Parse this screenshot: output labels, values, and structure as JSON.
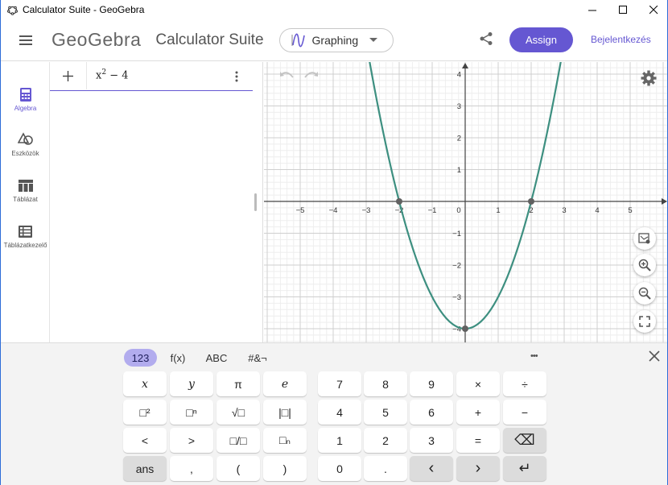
{
  "window": {
    "title": "Calculator Suite - GeoGebra"
  },
  "header": {
    "logo": "GeoGebra",
    "suite": "Calculator Suite",
    "app_picker": "Graphing",
    "assign": "Assign",
    "login": "Bejelentkezés"
  },
  "sidenav": {
    "items": [
      {
        "label": "Algebra",
        "icon": "calculator-icon",
        "active": true
      },
      {
        "label": "Eszközök",
        "icon": "shapes-icon",
        "active": false
      },
      {
        "label": "Táblázat",
        "icon": "table-icon",
        "active": false
      },
      {
        "label": "Táblázatkezelő",
        "icon": "spreadsheet-icon",
        "active": false
      }
    ]
  },
  "algebra": {
    "expression_base": "x",
    "expression_exp": "2",
    "expression_rest": " − 4"
  },
  "graph": {
    "function": "x^2 - 4",
    "x_ticks": [
      "−5",
      "−4",
      "−3",
      "−2",
      "−1",
      "0",
      "1",
      "2",
      "3",
      "4",
      "5"
    ],
    "y_ticks": [
      "4",
      "3",
      "2",
      "1",
      "−1",
      "−2",
      "−3",
      "−4"
    ],
    "roots": [
      -2,
      2
    ],
    "vertex": [
      0,
      -4
    ],
    "curve_color": "#3d8f80",
    "point_color": "#616161"
  },
  "keyboard": {
    "tabs": [
      "123",
      "f(x)",
      "ABC",
      "#&¬"
    ],
    "left_rows": [
      [
        "x",
        "y",
        "π",
        "e"
      ],
      [
        "□²",
        "□ⁿ",
        "√□",
        "|□|"
      ],
      [
        "<",
        ">",
        "□/□",
        "□ₙ"
      ],
      [
        "ans",
        ",",
        "(",
        ")"
      ]
    ],
    "right_rows": [
      [
        "7",
        "8",
        "9",
        "×",
        "÷"
      ],
      [
        "4",
        "5",
        "6",
        "+",
        "−"
      ],
      [
        "1",
        "2",
        "3",
        "=",
        "⌫"
      ],
      [
        "0",
        ".",
        "‹",
        "›",
        "↵"
      ]
    ],
    "more": "•••",
    "close": "×"
  },
  "colors": {
    "accent": "#6557d2",
    "active_tab": "#b2acee"
  }
}
